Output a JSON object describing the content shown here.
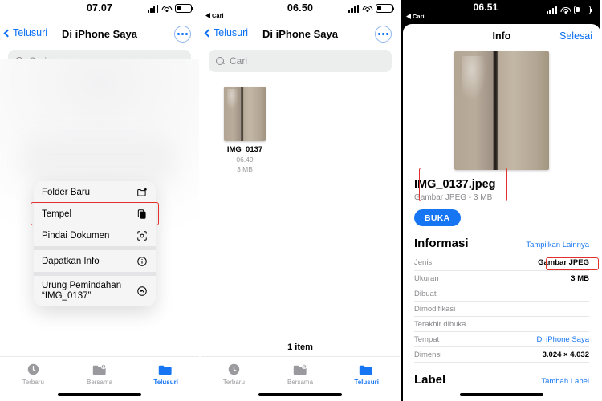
{
  "panel1": {
    "status": {
      "time": "07.07",
      "signal_icon": "cellular-signal-icon",
      "wifi_icon": "wifi-icon",
      "battery_icon": "battery-low-icon"
    },
    "nav": {
      "back_label": "Telusuri",
      "title": "Di iPhone Saya",
      "more_icon": "more-ellipsis-icon"
    },
    "search": {
      "placeholder": "Cari",
      "icon": "search-icon"
    },
    "context_menu": {
      "items": [
        {
          "label": "Folder Baru",
          "icon": "new-folder-icon",
          "highlighted": false
        },
        {
          "label": "Tempel",
          "icon": "paste-icon",
          "highlighted": true
        },
        {
          "label": "Pindai Dokumen",
          "icon": "scan-document-icon",
          "highlighted": false
        },
        {
          "label": "Dapatkan Info",
          "icon": "info-circle-icon",
          "highlighted": false
        },
        {
          "label": "Urung Pemindahan\n“IMG_0137”",
          "icon": "undo-icon",
          "highlighted": false
        }
      ]
    },
    "tabs": [
      {
        "label": "Terbaru",
        "icon": "clock-icon",
        "active": false
      },
      {
        "label": "Bersama",
        "icon": "shared-folder-icon",
        "active": false
      },
      {
        "label": "Telusuri",
        "icon": "folder-icon",
        "active": true
      }
    ]
  },
  "panel2": {
    "status": {
      "time": "06.50",
      "back_hint": "Cari",
      "signal_icon": "cellular-signal-icon",
      "wifi_icon": "wifi-icon",
      "battery_icon": "battery-low-icon"
    },
    "nav": {
      "back_label": "Telusuri",
      "title": "Di iPhone Saya",
      "more_icon": "more-ellipsis-icon"
    },
    "search": {
      "placeholder": "Cari",
      "icon": "search-icon"
    },
    "file": {
      "name": "IMG_0137",
      "time": "06.49",
      "size": "3 MB",
      "thumb_icon": "photo-thumbnail"
    },
    "item_count": "1 item",
    "tabs": [
      {
        "label": "Terbaru",
        "icon": "clock-icon",
        "active": false
      },
      {
        "label": "Bersama",
        "icon": "shared-folder-icon",
        "active": false
      },
      {
        "label": "Telusuri",
        "icon": "folder-icon",
        "active": true
      }
    ]
  },
  "panel3": {
    "status": {
      "time": "06.51",
      "back_hint": "Cari",
      "signal_icon": "cellular-signal-icon",
      "wifi_icon": "wifi-icon",
      "battery_icon": "battery-low-icon"
    },
    "sheet": {
      "title": "Info",
      "done_label": "Selesai"
    },
    "preview_icon": "photo-preview",
    "file": {
      "name": "IMG_0137.jpeg",
      "subtitle": "Gambar JPEG - 3 MB",
      "open_label": "BUKA"
    },
    "information": {
      "title": "Informasi",
      "show_more_label": "Tampilkan Lainnya",
      "rows": [
        {
          "key": "Jenis",
          "value": "Gambar JPEG",
          "link": false,
          "highlighted": true
        },
        {
          "key": "Ukuran",
          "value": "3 MB",
          "link": false,
          "highlighted": false
        },
        {
          "key": "Dibuat",
          "value": "",
          "link": false,
          "highlighted": false
        },
        {
          "key": "Dimodifikasi",
          "value": "",
          "link": false,
          "highlighted": false
        },
        {
          "key": "Terakhir dibuka",
          "value": "",
          "link": false,
          "highlighted": false
        },
        {
          "key": "Tempat",
          "value": "Di iPhone Saya",
          "link": true,
          "highlighted": false
        },
        {
          "key": "Dimensi",
          "value": "3.024 × 4.032",
          "link": false,
          "highlighted": false
        }
      ]
    },
    "label_section": {
      "title": "Label",
      "add_label": "Tambah Label"
    }
  },
  "colors": {
    "accent_blue": "#1575f2",
    "link_blue": "#0a70f5",
    "annotation_red": "#e0302b",
    "muted_gray": "#8a8a8e"
  }
}
